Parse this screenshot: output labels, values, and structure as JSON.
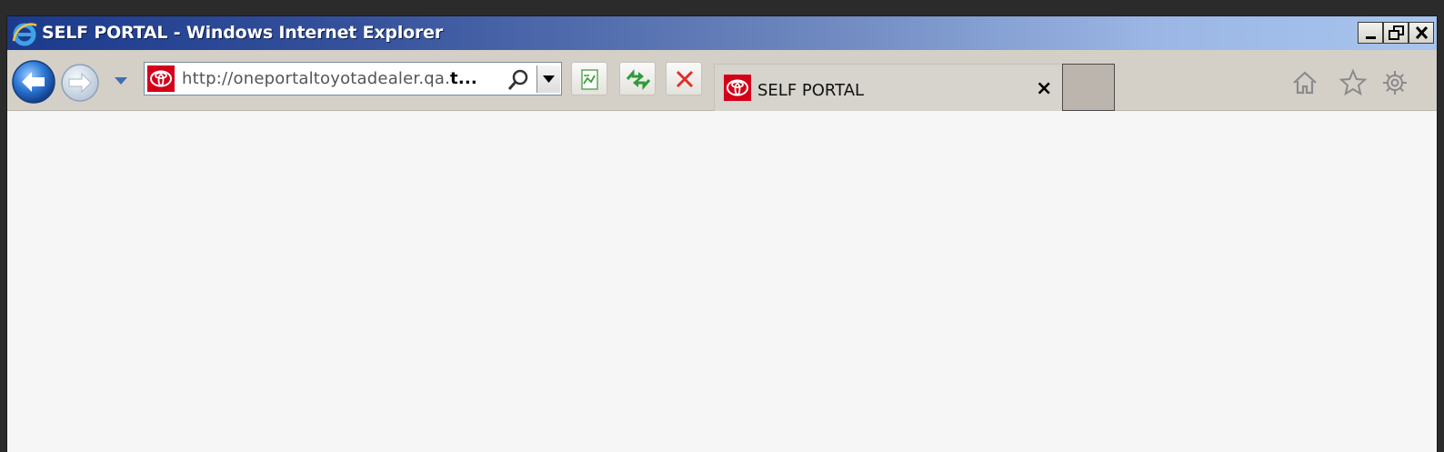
{
  "window": {
    "title": "SELF PORTAL - Windows Internet Explorer"
  },
  "address_bar": {
    "url_prefix": "http://oneportaltoyotadealer.qa.",
    "url_bold": "t...",
    "favicon": "toyota-logo-icon"
  },
  "toolbar": {
    "buttons": [
      "compatibility-view-icon",
      "refresh-icon",
      "stop-icon"
    ]
  },
  "tab": {
    "title": "SELF PORTAL",
    "close_label": "×"
  },
  "command_icons": [
    "home-icon",
    "favorites-star-icon",
    "tools-gear-icon"
  ],
  "colors": {
    "title_gradient_start": "#1c3a8c",
    "title_gradient_end": "#a7c4ee",
    "toolbar_bg": "#d4d0c8",
    "content_bg": "#f6f6f6",
    "toyota_red": "#d4001a"
  }
}
